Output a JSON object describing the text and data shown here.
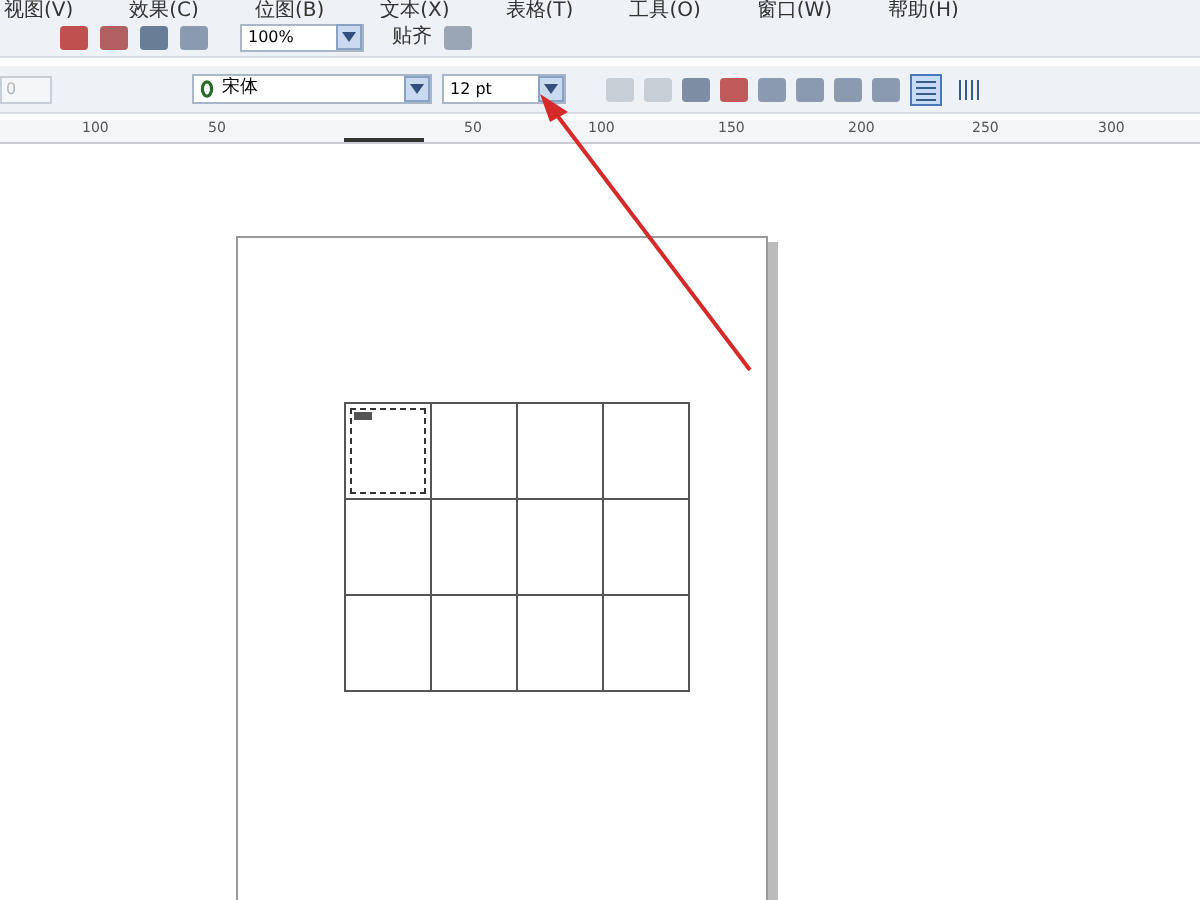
{
  "menu": [
    "视图(V)",
    "效果(C)",
    "位图(B)",
    "文本(X)",
    "表格(T)",
    "工具(O)",
    "窗口(W)",
    "帮助(H)"
  ],
  "toolbar": {
    "zoom": "100%",
    "snap": "贴齐"
  },
  "property_bar": {
    "field": "0",
    "font": "宋体",
    "size": "12 pt",
    "views": [
      {
        "selected": true
      },
      {
        "selected": false
      }
    ]
  },
  "ruler": {
    "labels": [
      "100",
      "50",
      "50",
      "100",
      "150",
      "200",
      "250",
      "300"
    ]
  },
  "table": {
    "rows": [
      {
        "cells": [
          {
            "selected": true
          },
          {
            "selected": false
          },
          {
            "selected": false
          },
          {
            "selected": false
          }
        ]
      },
      {
        "cells": [
          {
            "selected": false
          },
          {
            "selected": false
          },
          {
            "selected": false
          },
          {
            "selected": false
          }
        ]
      },
      {
        "cells": [
          {
            "selected": false
          },
          {
            "selected": false
          },
          {
            "selected": false
          },
          {
            "selected": false
          }
        ]
      }
    ]
  }
}
